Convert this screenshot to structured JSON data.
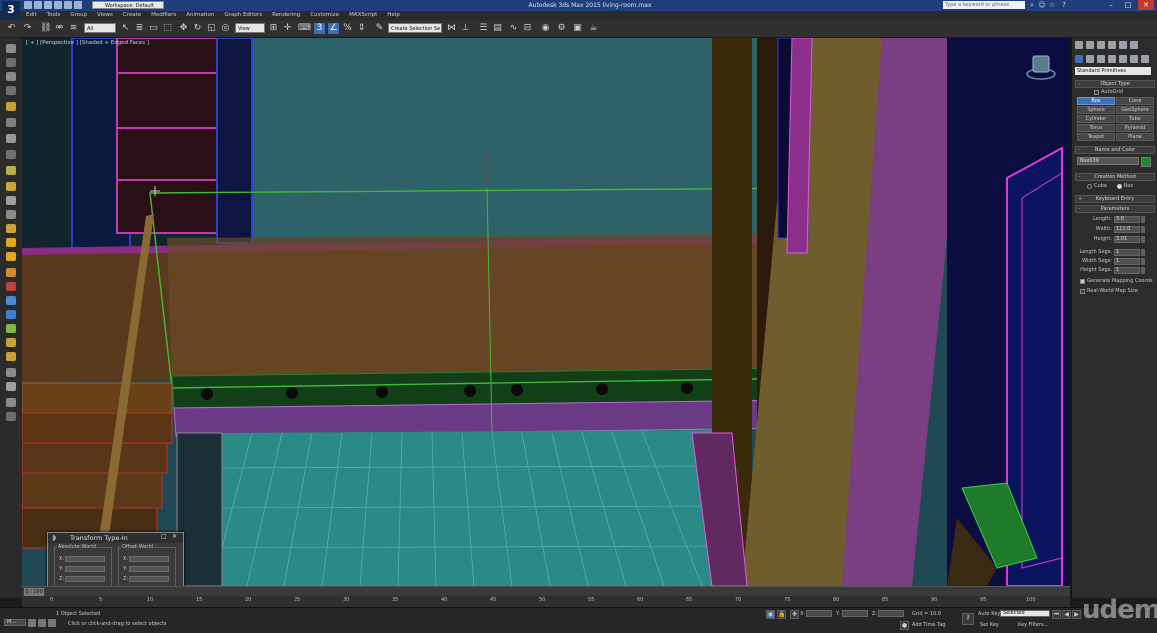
{
  "window": {
    "title": "Autodesk 3ds Max  2015    living-room.max",
    "workspace": "Workspace: Default",
    "search_placeholder": "Type a keyword or phrase"
  },
  "menu": [
    "Edit",
    "Tools",
    "Group",
    "Views",
    "Create",
    "Modifiers",
    "Animation",
    "Graph Editors",
    "Rendering",
    "Customize",
    "MAXScript",
    "Help"
  ],
  "toolbar": {
    "selection_filter": "All",
    "ref_coord": "View",
    "named_selection": "Create Selection Se"
  },
  "viewport": {
    "label": "[ + ] [Perspective ] [Shaded + Edged Faces ]"
  },
  "command_panel": {
    "category": "Standard Primitives",
    "object_type_title": "Object Type",
    "autogrid": "AutoGrid",
    "buttons": [
      "Box",
      "Cone",
      "Sphere",
      "GeoSphere",
      "Cylinder",
      "Tube",
      "Torus",
      "Pyramid",
      "Teapot",
      "Plane"
    ],
    "active_button": "Box",
    "name_color_title": "Name and Color",
    "object_name": "Box039",
    "creation_method_title": "Creation Method",
    "creation_options": [
      "Cube",
      "Box"
    ],
    "keyboard_entry_title": "Keyboard Entry",
    "parameters_title": "Parameters",
    "params": [
      {
        "label": "Length:",
        "value": "3.0"
      },
      {
        "label": "Width:",
        "value": "111.0"
      },
      {
        "label": "Height:",
        "value": "3.01"
      },
      {
        "label": "Length Segs:",
        "value": "1"
      },
      {
        "label": "Width Segs:",
        "value": "1"
      },
      {
        "label": "Height Segs:",
        "value": "1"
      }
    ],
    "gen_mapping": "Generate Mapping Coords.",
    "real_world": "Real-World Map Size"
  },
  "timeline": {
    "slider": "0 / 100",
    "ticks": [
      "0",
      "5",
      "10",
      "15",
      "20",
      "25",
      "30",
      "35",
      "40",
      "45",
      "50",
      "55",
      "60",
      "65",
      "70",
      "75",
      "80",
      "85",
      "90",
      "95",
      "100"
    ]
  },
  "status": {
    "selected": "1 Object Selected",
    "prompt": "Click or click-and-drag to select objects",
    "listener": "M...",
    "grid": "Grid = 10.0",
    "auto_key": "Auto Key",
    "set_key": "Set Key",
    "key_mode": "Selected",
    "key_filters": "Key Filters...",
    "add_time_tag": "Add Time Tag"
  },
  "transform_dialog": {
    "title": "Transform Type-In",
    "absolute": "Absolute:World",
    "offset": "Offset:World",
    "axes": [
      "X:",
      "Y:",
      "Z:"
    ]
  },
  "watermark": "udemy",
  "colors": {
    "title_bar": "#1e3f7a",
    "active_button": "#3e6fb5",
    "close": "#c23b2b"
  }
}
